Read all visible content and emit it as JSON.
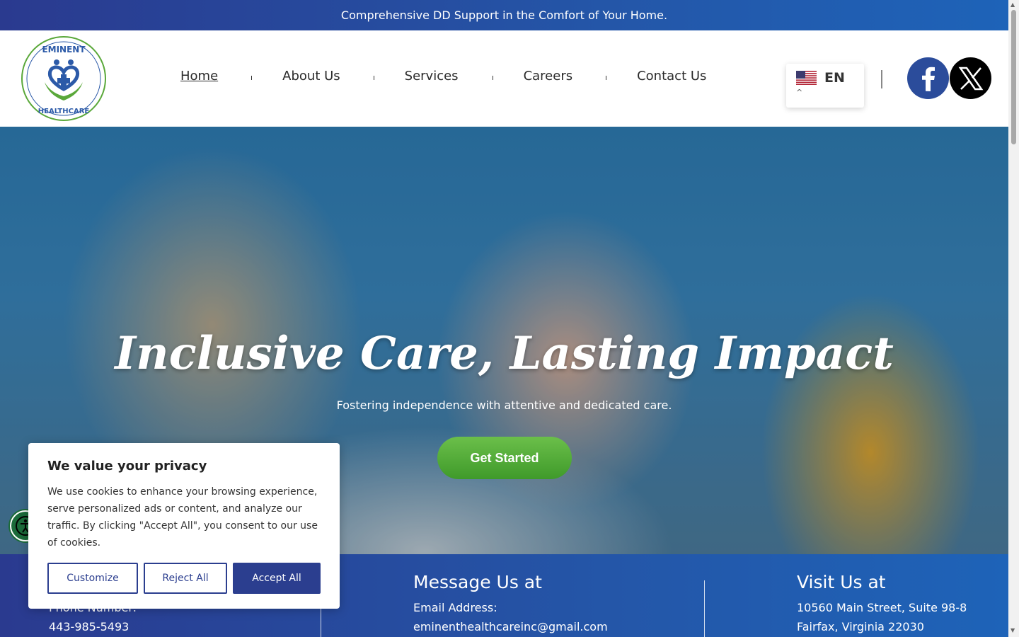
{
  "announcement": "Comprehensive DD Support in the Comfort of Your Home.",
  "brand": {
    "logo_top": "EMINENT",
    "logo_bottom": "HEALTHCARE"
  },
  "nav": {
    "items": [
      "Home",
      "About Us",
      "Services",
      "Careers",
      "Contact Us"
    ],
    "active": "Home"
  },
  "language": {
    "code": "EN",
    "flag": "us-flag-icon"
  },
  "social": {
    "facebook_icon": "facebook-icon",
    "x_icon": "x-icon"
  },
  "hero": {
    "title": "Inclusive Care, Lasting Impact",
    "subtitle": "Fostering independence with attentive and dedicated care.",
    "cta": "Get Started"
  },
  "info": {
    "call": {
      "label": "Phone Number:",
      "value": "443-985-5493"
    },
    "message": {
      "heading": "Message Us at",
      "label": "Email Address:",
      "value": "eminenthealthcareinc@gmail.com"
    },
    "visit": {
      "heading": "Visit Us at",
      "line1": "10560 Main Street, Suite 98-8",
      "line2": "Fairfax, Virginia 22030"
    }
  },
  "cookie": {
    "title": "We value your privacy",
    "body": "We use cookies to enhance your browsing experience, serve personalized ads or content, and analyze our traffic. By clicking \"Accept All\", you consent to our use of cookies.",
    "customize": "Customize",
    "reject": "Reject All",
    "accept": "Accept All"
  },
  "colors": {
    "brand_blue": "#2b3e8f",
    "cta_green": "#4fa835",
    "banner_blue": "#2456a8"
  }
}
